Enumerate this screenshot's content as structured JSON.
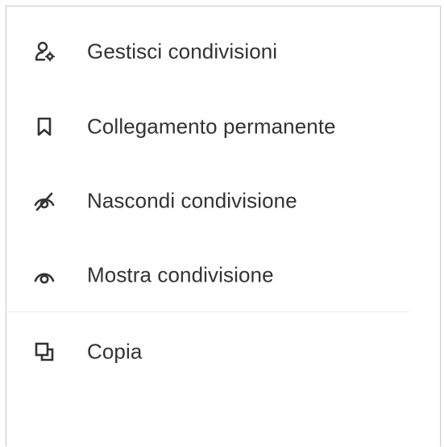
{
  "menu": {
    "items": [
      {
        "label": "Gestisci condivisioni",
        "icon": "user-gear-icon"
      },
      {
        "label": "Collegamento permanente",
        "icon": "bookmark-icon"
      },
      {
        "label": "Nascondi condivisione",
        "icon": "eye-off-icon"
      },
      {
        "label": "Mostra condivisione",
        "icon": "eye-icon"
      },
      {
        "label": "Copia",
        "icon": "copy-icon"
      }
    ]
  },
  "colors": {
    "text": "#333333",
    "icon": "#333333",
    "border": "#c8c8c8",
    "divider": "#ececec"
  }
}
